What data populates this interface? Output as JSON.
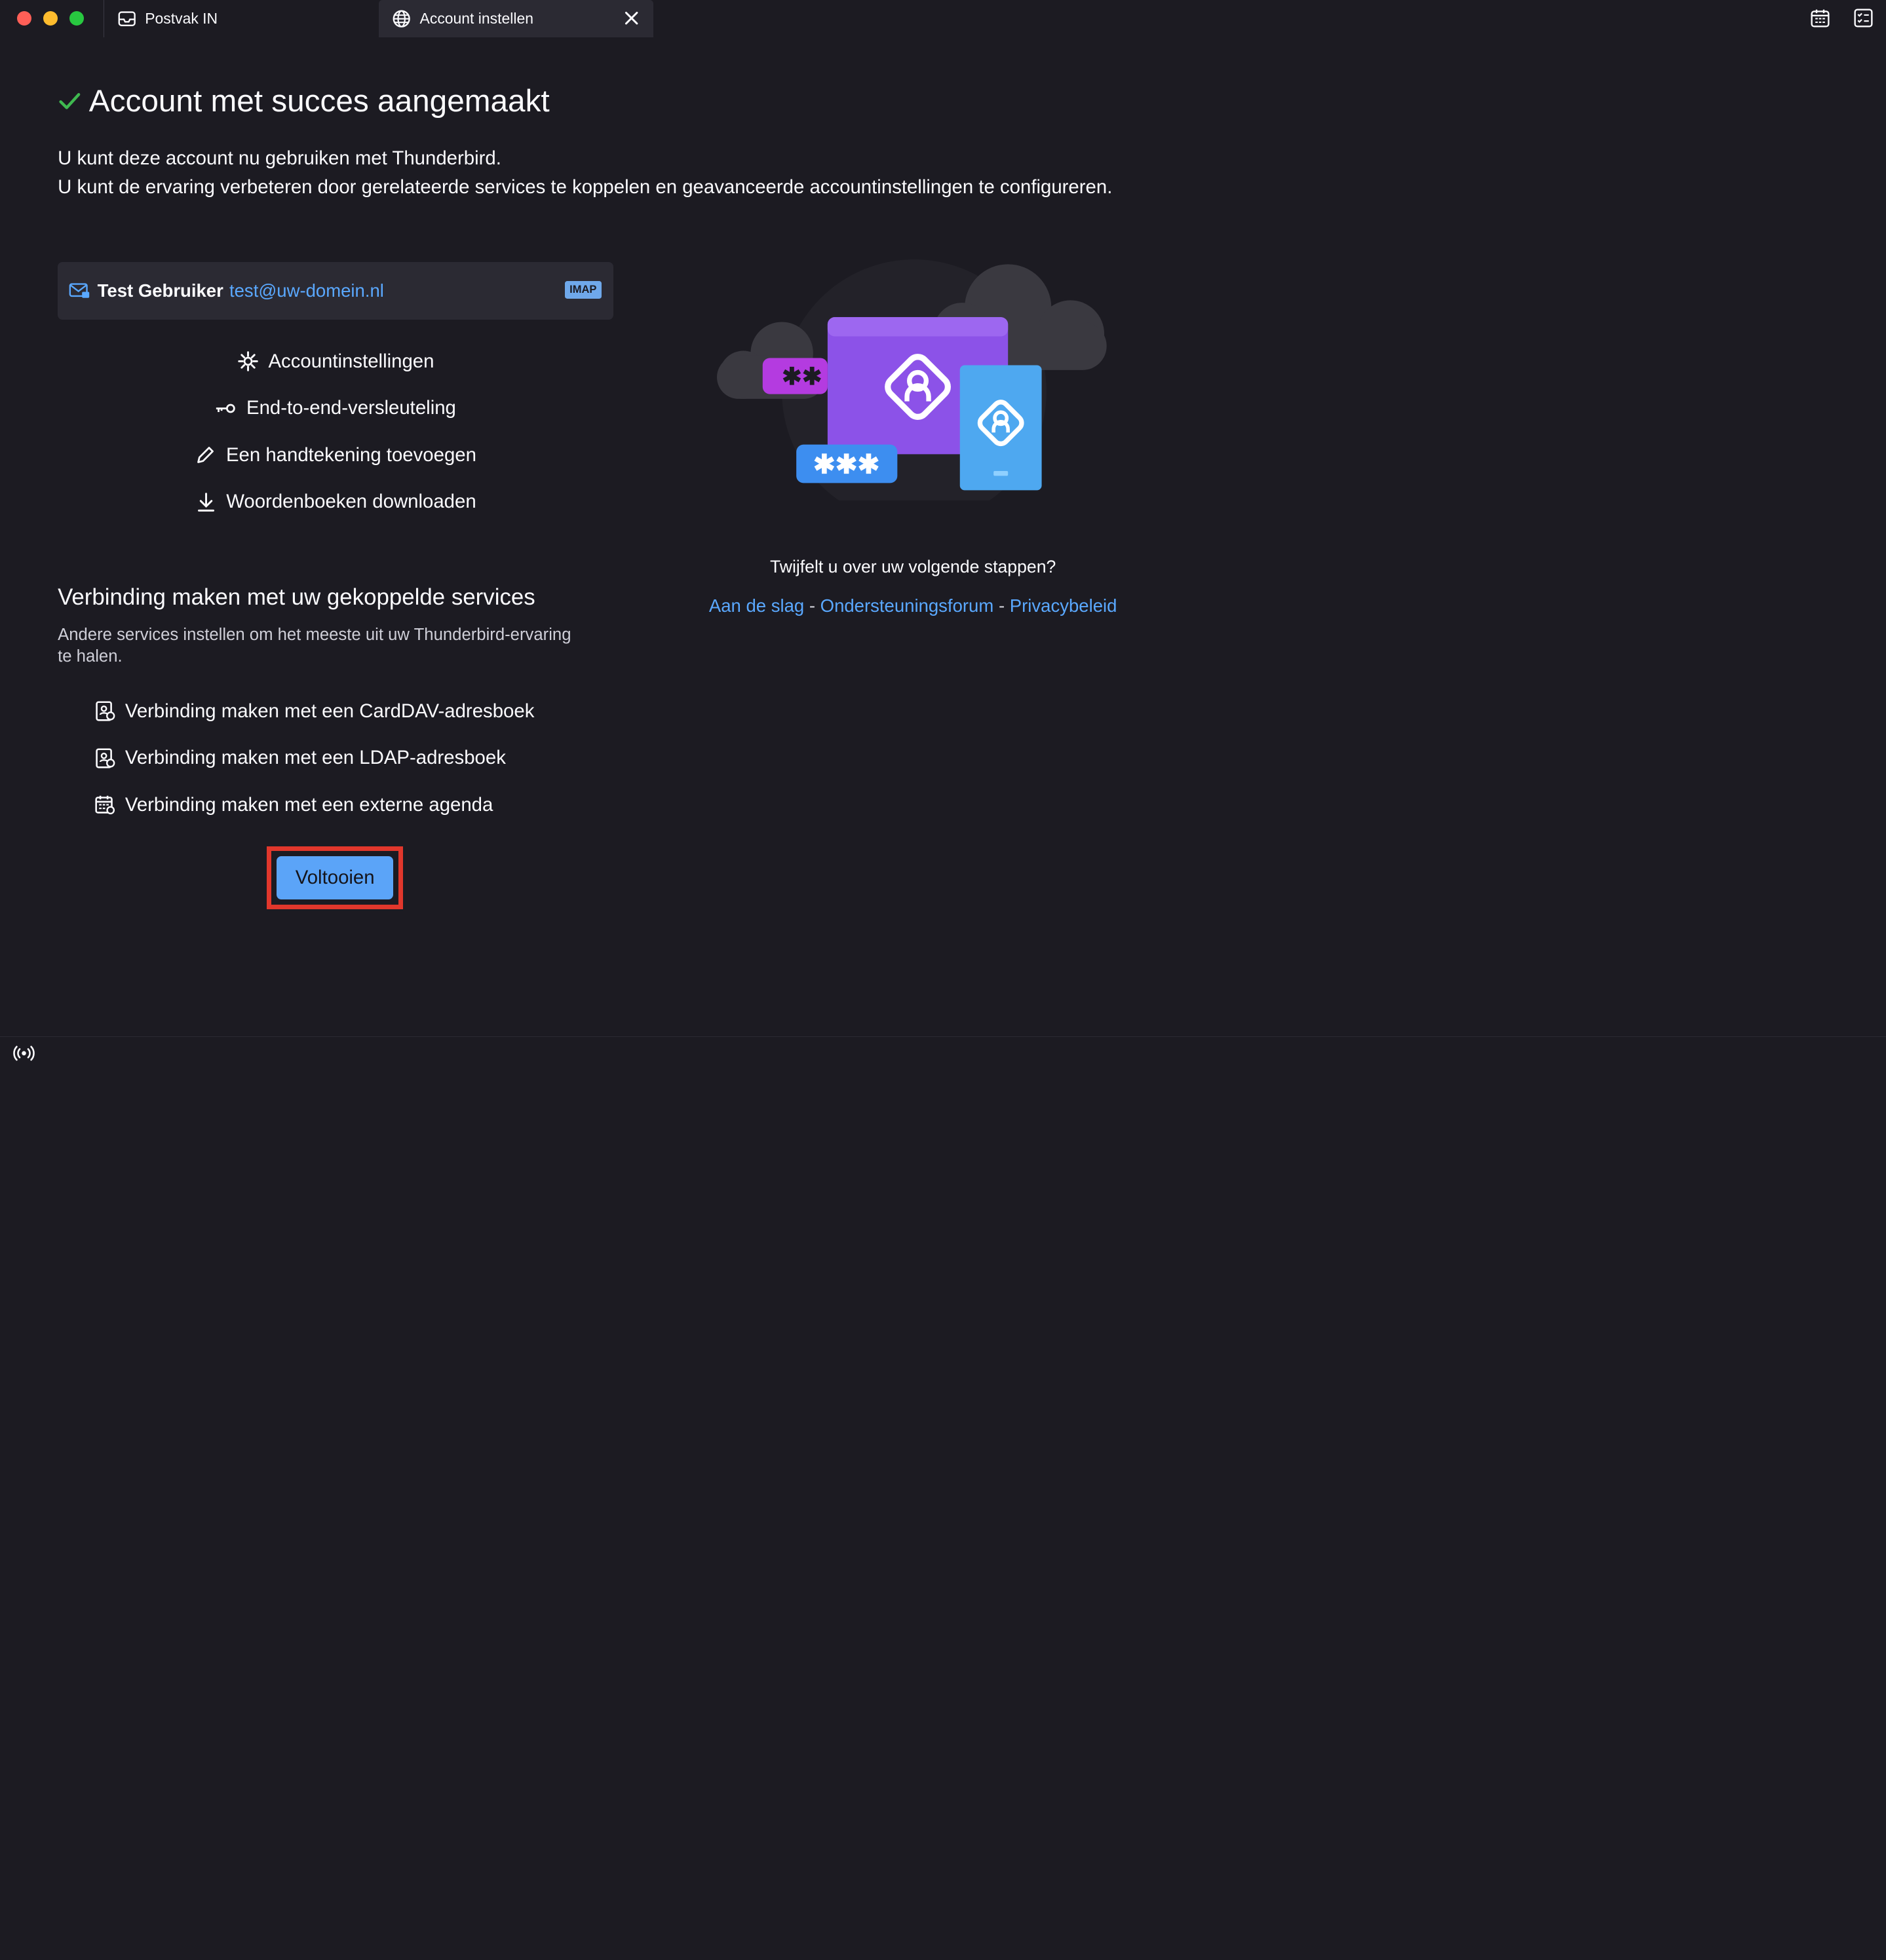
{
  "tabs": [
    {
      "label": "Postvak IN",
      "icon": "inbox-icon",
      "active": false
    },
    {
      "label": "Account instellen",
      "icon": "globe-icon",
      "active": true
    }
  ],
  "heading": "Account met succes aangemaakt",
  "intro": {
    "line1": "U kunt deze account nu gebruiken met Thunderbird.",
    "line2": "U kunt de ervaring verbeteren door gerelateerde services te koppelen en geavanceerde accountinstellingen te configureren."
  },
  "account": {
    "name": "Test Gebruiker",
    "email": "test@uw-domein.nl",
    "protocol": "IMAP"
  },
  "actions": [
    {
      "label": "Accountinstellingen",
      "icon": "gear-icon"
    },
    {
      "label": "End-to-end-versleuteling",
      "icon": "key-icon"
    },
    {
      "label": "Een handtekening toevoegen",
      "icon": "pencil-icon"
    },
    {
      "label": "Woordenboeken downloaden",
      "icon": "download-icon"
    }
  ],
  "services": {
    "title": "Verbinding maken met uw gekoppelde services",
    "description": "Andere services instellen om het meeste uit uw Thunderbird-ervaring te halen.",
    "items": [
      {
        "label": "Verbinding maken met een CardDAV-adresboek",
        "icon": "address-book-icon"
      },
      {
        "label": "Verbinding maken met een LDAP-adresboek",
        "icon": "address-book-icon"
      },
      {
        "label": "Verbinding maken met een externe agenda",
        "icon": "calendar-icon"
      }
    ]
  },
  "finish_label": "Voltooien",
  "help": {
    "question": "Twijfelt u over uw volgende stappen?",
    "links": [
      "Aan de slag",
      "Ondersteuningsforum",
      "Privacybeleid"
    ],
    "separator": "-"
  },
  "colors": {
    "background": "#1c1b22",
    "accent": "#5ba4f8",
    "link": "#5aa8ff",
    "success": "#3fe1b0",
    "highlight": "#e1372c"
  }
}
